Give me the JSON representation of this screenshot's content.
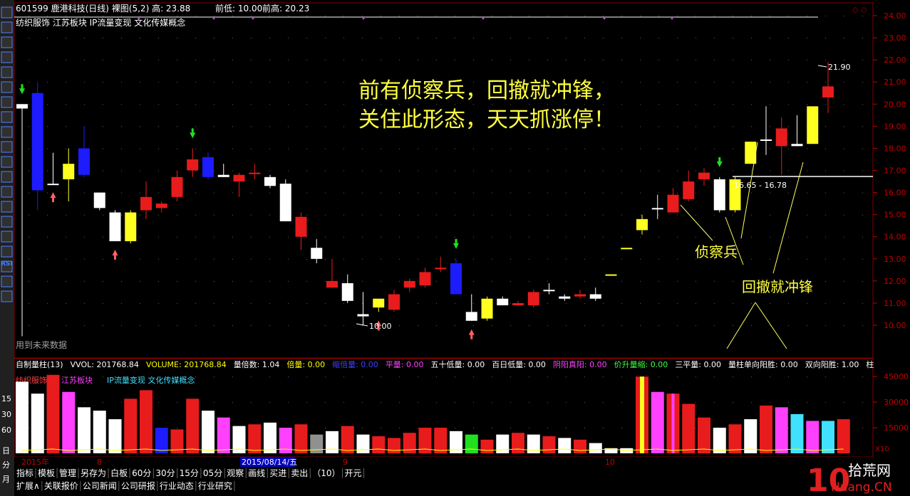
{
  "header": {
    "line1": "601599 鹿港科技(日线) 裸图(5,2) 高: 23.88",
    "prev_low": "前低: 10.00",
    "prev_high": "前高: 20.23",
    "tags": "纺织服饰 江苏板块 IP流量变现 文化传媒概念"
  },
  "annotations": {
    "headline_1": "前有侦察兵，回撤就冲锋，",
    "headline_2": "关住此形态，天天抓涨停！",
    "scout": "侦察兵",
    "charge": "回撤就冲锋",
    "range": "16.65 - 16.78",
    "high_mark": "21.90",
    "low_mark": "10.00",
    "future_data": "用到未来数据"
  },
  "volume_header": {
    "items": [
      {
        "label": "自制量柱(13)",
        "color": "#ffffff"
      },
      {
        "label": "VVOL: 201768.84",
        "color": "#ffffff"
      },
      {
        "label": "VOLUME: 201768.84",
        "color": "#ffff00"
      },
      {
        "label": "量倍数: 1.04",
        "color": "#ffffff"
      },
      {
        "label": "倍量: 0.00",
        "color": "#ffff00"
      },
      {
        "label": "缩倍量: 0.00",
        "color": "#4040ff"
      },
      {
        "label": "平量: 0.00",
        "color": "#ff40ff"
      },
      {
        "label": "五十低量: 0.00",
        "color": "#ffffff"
      },
      {
        "label": "百日低量: 0.00",
        "color": "#ffffff"
      },
      {
        "label": "阴阳真阳: 0.00",
        "color": "#ff40ff"
      },
      {
        "label": "价升量缩: 0.00",
        "color": "#40ff40"
      },
      {
        "label": "三平量: 0.00",
        "color": "#ffffff"
      },
      {
        "label": "量柱单向阳胜: 0.00",
        "color": "#ffffff"
      },
      {
        "label": "双向阳胜: 1.00",
        "color": "#ffffff"
      },
      {
        "label": "柱",
        "color": "#ffffff"
      }
    ],
    "tags": [
      {
        "label": "纺织服饰",
        "color": "#ff4040"
      },
      {
        "label": "江苏板块",
        "color": "#ff40ff"
      },
      {
        "label": "IP流量变现 文化传媒概念",
        "color": "#40e0ff"
      }
    ]
  },
  "date_axis": {
    "year": "2015年",
    "m8": "8",
    "selected_date": "2015/08/14/五",
    "m9": "9",
    "m10": "10",
    "x10": "X10"
  },
  "toolbar_row1": [
    "指标",
    "模板",
    "管理",
    "另存为",
    "白板",
    "60分",
    "30分",
    "15分",
    "05分",
    "观察",
    "画线",
    "买进",
    "卖出",
    "（10）",
    "开元"
  ],
  "toolbar_row2": [
    "扩展∧",
    "关联报价",
    "公司新闻",
    "公司研报",
    "行业动态",
    "行业研究"
  ],
  "left_tools": [
    "日",
    "分",
    "月"
  ],
  "left_periods": [
    "15",
    "30",
    "60"
  ],
  "left_rsi": "RSI",
  "watermark": {
    "main": "拾荒网",
    "sub": "Huang.CN"
  },
  "chart_data": [
    {
      "type": "candlestick",
      "price_axis_ticks": [
        24,
        23,
        22,
        21,
        20,
        19,
        18,
        17,
        16,
        15,
        14,
        13,
        12,
        11,
        10
      ],
      "price_axis_labels": [
        "24.00",
        "23.00",
        "22.00",
        "21.00",
        "20.00",
        "19.00",
        "18.00",
        "17.00",
        "16.00",
        "15.00",
        "14.00",
        "13.00",
        "12.00",
        "11.00",
        "10.00"
      ],
      "ylim": [
        9.4,
        24.5
      ],
      "candles": [
        {
          "o": 20.0,
          "c": 19.8,
          "h": 20.0,
          "l": 9.5,
          "color": "white"
        },
        {
          "o": 20.5,
          "c": 16.1,
          "h": 21.0,
          "l": 15.2,
          "color": "blue"
        },
        {
          "o": 16.4,
          "c": 16.4,
          "h": 17.8,
          "l": 16.4,
          "color": "white"
        },
        {
          "o": 17.3,
          "c": 16.6,
          "h": 18.0,
          "l": 15.6,
          "color": "yellow"
        },
        {
          "o": 18.0,
          "c": 16.8,
          "h": 19.0,
          "l": 16.7,
          "color": "blue"
        },
        {
          "o": 16.0,
          "c": 15.3,
          "h": 16.0,
          "l": 15.2,
          "color": "white"
        },
        {
          "o": 15.1,
          "c": 13.8,
          "h": 15.2,
          "l": 13.8,
          "color": "white"
        },
        {
          "o": 15.1,
          "c": 13.8,
          "h": 15.2,
          "l": 13.7,
          "color": "yellow"
        },
        {
          "o": 15.2,
          "c": 15.8,
          "h": 16.5,
          "l": 14.8,
          "color": "red"
        },
        {
          "o": 15.3,
          "c": 15.5,
          "h": 15.6,
          "l": 15.1,
          "color": "red"
        },
        {
          "o": 15.8,
          "c": 16.7,
          "h": 17.0,
          "l": 15.6,
          "color": "red"
        },
        {
          "o": 17.0,
          "c": 17.5,
          "h": 18.0,
          "l": 16.7,
          "color": "red"
        },
        {
          "o": 17.6,
          "c": 16.7,
          "h": 17.8,
          "l": 16.6,
          "color": "blue"
        },
        {
          "o": 16.8,
          "c": 16.7,
          "h": 17.3,
          "l": 16.7,
          "color": "white"
        },
        {
          "o": 16.5,
          "c": 16.8,
          "h": 16.9,
          "l": 15.8,
          "color": "red"
        },
        {
          "o": 16.9,
          "c": 16.9,
          "h": 17.3,
          "l": 16.6,
          "color": "red"
        },
        {
          "o": 16.7,
          "c": 16.3,
          "h": 16.8,
          "l": 16.2,
          "color": "white"
        },
        {
          "o": 16.4,
          "c": 14.7,
          "h": 16.6,
          "l": 14.7,
          "color": "white"
        },
        {
          "o": 14.9,
          "c": 14.0,
          "h": 15.1,
          "l": 13.4,
          "color": "red"
        },
        {
          "o": 13.5,
          "c": 13.0,
          "h": 13.9,
          "l": 12.8,
          "color": "white"
        },
        {
          "o": 12.0,
          "c": 11.7,
          "h": 13.0,
          "l": 11.7,
          "color": "red"
        },
        {
          "o": 11.9,
          "c": 11.1,
          "h": 12.3,
          "l": 11.0,
          "color": "white"
        },
        {
          "o": 10.5,
          "c": 10.4,
          "h": 11.5,
          "l": 10.0,
          "color": "white"
        },
        {
          "o": 10.8,
          "c": 11.2,
          "h": 11.2,
          "l": 10.6,
          "color": "yellow"
        },
        {
          "o": 10.7,
          "c": 11.4,
          "h": 11.6,
          "l": 10.6,
          "color": "red"
        },
        {
          "o": 11.7,
          "c": 12.0,
          "h": 12.1,
          "l": 11.5,
          "color": "red"
        },
        {
          "o": 11.8,
          "c": 12.4,
          "h": 12.6,
          "l": 11.7,
          "color": "red"
        },
        {
          "o": 12.6,
          "c": 12.6,
          "h": 13.1,
          "l": 12.4,
          "color": "red"
        },
        {
          "o": 12.8,
          "c": 11.4,
          "h": 13.0,
          "l": 11.4,
          "color": "blue"
        },
        {
          "o": 10.6,
          "c": 10.2,
          "h": 11.4,
          "l": 10.2,
          "color": "white"
        },
        {
          "o": 11.2,
          "c": 10.3,
          "h": 11.3,
          "l": 10.2,
          "color": "yellow"
        },
        {
          "o": 11.2,
          "c": 10.9,
          "h": 11.3,
          "l": 10.9,
          "color": "white"
        },
        {
          "o": 10.9,
          "c": 11.0,
          "h": 11.1,
          "l": 10.9,
          "color": "red"
        },
        {
          "o": 10.9,
          "c": 11.5,
          "h": 11.6,
          "l": 10.8,
          "color": "red"
        },
        {
          "o": 11.6,
          "c": 11.6,
          "h": 11.9,
          "l": 11.4,
          "color": "white"
        },
        {
          "o": 11.2,
          "c": 11.3,
          "h": 11.4,
          "l": 11.1,
          "color": "white"
        },
        {
          "o": 11.3,
          "c": 11.4,
          "h": 11.6,
          "l": 11.2,
          "color": "red"
        },
        {
          "o": 11.4,
          "c": 11.2,
          "h": 11.7,
          "l": 11.1,
          "color": "white"
        },
        {
          "o": 12.3,
          "c": 12.3,
          "h": 12.3,
          "l": 12.3,
          "color": "yellow"
        },
        {
          "o": 13.5,
          "c": 13.5,
          "h": 13.5,
          "l": 13.5,
          "color": "yellow"
        },
        {
          "o": 14.3,
          "c": 14.8,
          "h": 15.0,
          "l": 14.1,
          "color": "yellow"
        },
        {
          "o": 15.3,
          "c": 15.3,
          "h": 15.9,
          "l": 14.8,
          "color": "white"
        },
        {
          "o": 15.1,
          "c": 15.9,
          "h": 16.2,
          "l": 15.1,
          "color": "red"
        },
        {
          "o": 15.7,
          "c": 16.5,
          "h": 17.0,
          "l": 15.6,
          "color": "red"
        },
        {
          "o": 16.6,
          "c": 16.9,
          "h": 17.1,
          "l": 16.3,
          "color": "red"
        },
        {
          "o": 16.6,
          "c": 15.2,
          "h": 16.7,
          "l": 15.1,
          "color": "white"
        },
        {
          "o": 16.6,
          "c": 15.2,
          "h": 16.7,
          "l": 15.1,
          "color": "yellow"
        },
        {
          "o": 17.3,
          "c": 18.3,
          "h": 18.3,
          "l": 17.3,
          "color": "yellow"
        },
        {
          "o": 18.4,
          "c": 18.4,
          "h": 19.9,
          "l": 17.7,
          "color": "white"
        },
        {
          "o": 18.9,
          "c": 18.1,
          "h": 19.4,
          "l": 16.8,
          "color": "red"
        },
        {
          "o": 18.1,
          "c": 18.2,
          "h": 19.5,
          "l": 18.1,
          "color": "white"
        },
        {
          "o": 18.2,
          "c": 19.9,
          "h": 19.9,
          "l": 18.2,
          "color": "yellow"
        },
        {
          "o": 20.3,
          "c": 20.8,
          "h": 21.9,
          "l": 19.6,
          "color": "red"
        }
      ]
    },
    {
      "type": "bar",
      "title": "自制量柱(13)",
      "axis_labels": [
        "45000",
        "30000",
        "15000"
      ],
      "axis_ticks": [
        45000,
        30000,
        15000
      ],
      "ylim": [
        0,
        48000
      ],
      "values": [
        42000,
        35000,
        46000,
        36000,
        27000,
        25000,
        20000,
        32000,
        37000,
        15000,
        14000,
        32000,
        25000,
        21000,
        16000,
        17000,
        18000,
        15000,
        17000,
        11000,
        13000,
        16000,
        11000,
        10000,
        9000,
        12000,
        15000,
        15000,
        13000,
        11000,
        8000,
        11000,
        12000,
        11000,
        10000,
        9000,
        8000,
        6000,
        3000,
        3000,
        45000,
        36000,
        35000,
        29000,
        21000,
        15000,
        17000,
        20000,
        28000,
        27000,
        23000,
        19000,
        19000,
        20000
      ],
      "colors": [
        "white",
        "white",
        "red",
        "pink",
        "white",
        "white",
        "white",
        "red",
        "red",
        "blue",
        "red",
        "red",
        "white",
        "pink",
        "white",
        "red",
        "white",
        "pink",
        "red",
        "gray",
        "white",
        "red",
        "white",
        "red",
        "red",
        "red",
        "red",
        "red",
        "white",
        "green",
        "red",
        "white",
        "red",
        "white",
        "red",
        "white",
        "red",
        "white",
        "white",
        "white",
        "yellowred",
        "pink",
        "pinkred",
        "red",
        "red",
        "white",
        "red",
        "white",
        "red",
        "pink",
        "cyan",
        "pink",
        "cyan",
        "red"
      ]
    }
  ]
}
